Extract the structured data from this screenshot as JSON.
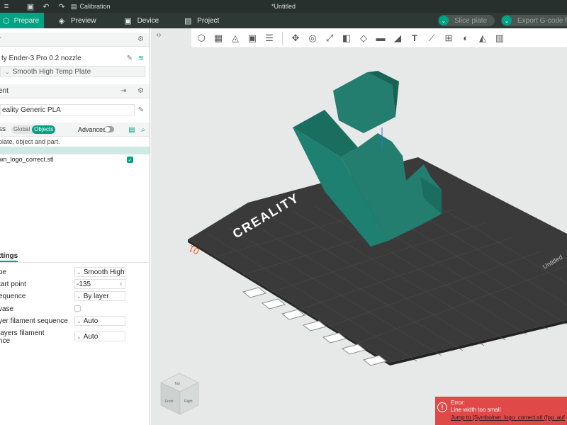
{
  "titlebar": {
    "calibration_label": "Calibration",
    "document_title": "*Untitled"
  },
  "tabs": [
    {
      "label": "Prepare",
      "icon": "cube-icon"
    },
    {
      "label": "Preview",
      "icon": "layers-icon"
    },
    {
      "label": "Device",
      "icon": "device-icon"
    },
    {
      "label": "Project",
      "icon": "project-icon"
    }
  ],
  "actions": {
    "slice_label": "Slice plate",
    "export_label": "Export G-code fi"
  },
  "printer": {
    "header_label": "r",
    "printer_name": "ty Ender-3 Pro 0.2 nozzle",
    "plate_type": "Smooth High Temp Plate"
  },
  "filament": {
    "header_label": "ent",
    "filament_name": "eality Generic PLA"
  },
  "objects": {
    "header_label": "ss",
    "toggle_global": "Global",
    "toggle_objects": "Objects",
    "advanced_label": "Advanced",
    "hint": "plate, object and part.",
    "file_name": "wn_logo_correct.stl"
  },
  "settings": {
    "tab_label": "ttings",
    "rows": [
      {
        "label": "pe",
        "value": "Smooth High..."
      },
      {
        "label": "tart point",
        "value": "-135"
      },
      {
        "label": "equence",
        "value": "By layer"
      },
      {
        "label": "vase",
        "value": ""
      },
      {
        "label": "yer filament sequence",
        "value": "Auto"
      },
      {
        "label": "layers filament",
        "label2": "nce",
        "value": "Auto"
      }
    ]
  },
  "plate": {
    "brand_text": "CREALITY",
    "plate_number": "01",
    "plate_name_right": "Untitled"
  },
  "view_cube": {
    "top": "Top",
    "front": "Front",
    "right": "Right"
  },
  "error": {
    "title": "Error:",
    "message": "Line width too small",
    "link": "Jump to [Symbolnet_logo_correct.stl (fpp_auf"
  },
  "colors": {
    "accent": "#00a383",
    "model": "#1e7d6d",
    "error": "#e14848"
  }
}
